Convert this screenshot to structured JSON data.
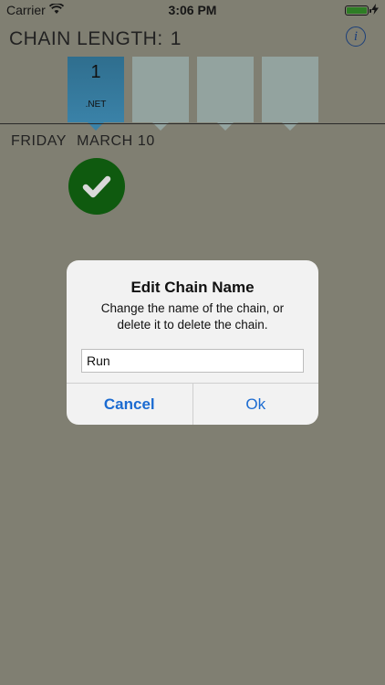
{
  "status_bar": {
    "carrier": "Carrier",
    "time": "3:06 PM",
    "wifi_icon": "wifi-icon",
    "battery_icon": "battery-icon",
    "charging_icon": "charging-bolt-icon"
  },
  "header": {
    "label": "CHAIN LENGTH:",
    "value": "1",
    "info_icon": "info-icon",
    "info_glyph": "i"
  },
  "chains": [
    {
      "count": "1",
      "name": ".NET",
      "active": true
    },
    {
      "count": "",
      "name": "",
      "active": false
    },
    {
      "count": "",
      "name": "",
      "active": false
    },
    {
      "count": "",
      "name": "",
      "active": false
    }
  ],
  "date": {
    "day": "FRIDAY",
    "month_day": "MARCH 10",
    "status_icon": "checkmark-icon"
  },
  "dialog": {
    "title": "Edit Chain Name",
    "message": "Change the name of the chain, or delete it to delete the chain.",
    "input_value": "Run",
    "cancel_label": "Cancel",
    "ok_label": "Ok"
  },
  "colors": {
    "background_dimmed": "#807F72",
    "active_tile": "#3A82A8",
    "inactive_tile": "#93A39F",
    "check_green": "#0F5A0F",
    "button_blue": "#1B6BD1"
  }
}
